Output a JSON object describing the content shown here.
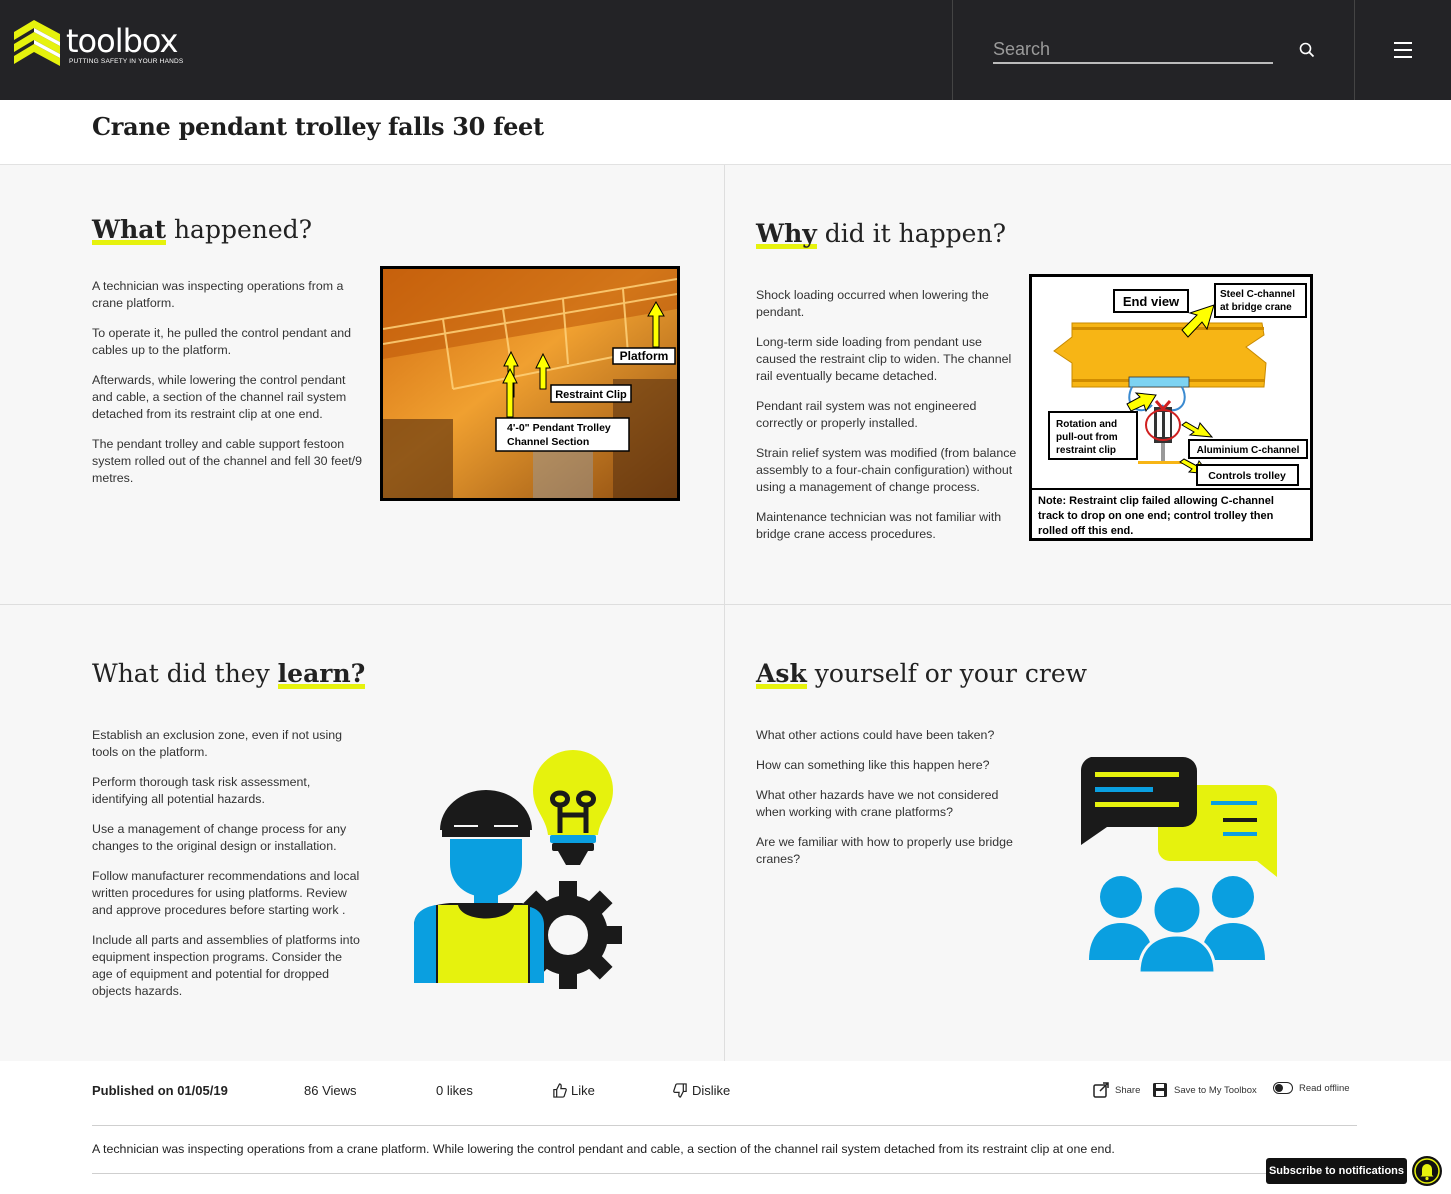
{
  "header": {
    "logo_text": "toolbox",
    "logo_tagline": "PUTTING SAFETY IN YOUR HANDS",
    "search_placeholder": "Search",
    "icons": {
      "search": "search-icon",
      "menu": "hamburger-menu-icon"
    }
  },
  "page": {
    "title": "Crane pendant trolley falls 30 feet"
  },
  "what": {
    "heading_bold": "What",
    "heading_rest": " happened?",
    "paragraphs": [
      "A technician was inspecting operations from a crane platform.",
      "To operate it, he pulled the control pendant and cables up to the platform.",
      "Afterwards, while lowering the control pendant and cable, a section of the channel rail system detached from its restraint clip at one end.",
      "The pendant trolley and cable support festoon system rolled out of the channel and fell 30 feet/9 metres."
    ],
    "photo_labels": {
      "platform": "Platform",
      "restraint_clip": "Restraint Clip",
      "trolley_line1": "4'-0\" Pendant Trolley",
      "trolley_line2": "Channel Section"
    }
  },
  "why": {
    "heading_bold": "Why",
    "heading_rest": " did it happen?",
    "paragraphs": [
      "Shock loading occurred when lowering the pendant.",
      "Long-term side loading from pendant use caused the restraint clip to widen. The channel rail eventually became detached.",
      "Pendant rail system was not engineered correctly or properly installed.",
      "Strain relief system was modified (from balance assembly to a four-chain configuration) without using a management of change process.",
      "Maintenance technician was not familiar with bridge  crane  access procedures."
    ],
    "diagram_labels": {
      "end_view": "End view",
      "steel_line1": "Steel C-channel",
      "steel_line2": "at bridge crane",
      "rotation_line1": "Rotation and",
      "rotation_line2": "pull-out from",
      "rotation_line3": "restraint clip",
      "aluminium": "Aluminium C-channel",
      "controls": "Controls trolley",
      "note_line1": "Note: Restraint clip failed allowing C-channel",
      "note_line2": "track to drop on one end; control trolley then",
      "note_line3": "rolled off this end."
    }
  },
  "learn": {
    "heading_plain": "What did they ",
    "heading_bold": "learn?",
    "paragraphs": [
      "Establish an exclusion zone, even if not using tools on the platform.",
      "Perform thorough task risk assessment, identifying all potential hazards.",
      "Use  a management of change process for any changes to the original design or installation.",
      "Follow manufacturer recommendations and local written procedures for using platforms. Review and approve procedures before starting work .",
      "Include all parts and assemblies of platforms into equipment inspection programs.  Consider the age of equipment and potential for dropped objects hazards."
    ],
    "illustration": "worker-lightbulb-gear-icon"
  },
  "ask": {
    "heading_bold": "Ask",
    "heading_rest": " yourself or your crew",
    "paragraphs": [
      "What other actions could have been taken?",
      "How can something like this happen here?",
      "What other hazards have we not considered when working with crane platforms?",
      "Are we familiar with how to properly use bridge cranes?"
    ],
    "illustration": "chat-bubbles-group-icon"
  },
  "footer": {
    "published": "Published on 01/05/19",
    "views": "86 Views",
    "likes": "0 likes",
    "like_label": "Like",
    "dislike_label": "Dislike",
    "share_label": "Share",
    "save_label": "Save to My Toolbox",
    "offline_label": "Read offline",
    "summary": "A technician was inspecting operations from a crane platform. While lowering the control pendant and cable, a section of the channel rail system detached from its restraint clip at one end."
  },
  "notifications": {
    "subscribe_label": "Subscribe to notifications"
  },
  "colors": {
    "accent_yellow": "#e6f20d",
    "accent_blue": "#0a9fe0",
    "dark": "#232326"
  }
}
